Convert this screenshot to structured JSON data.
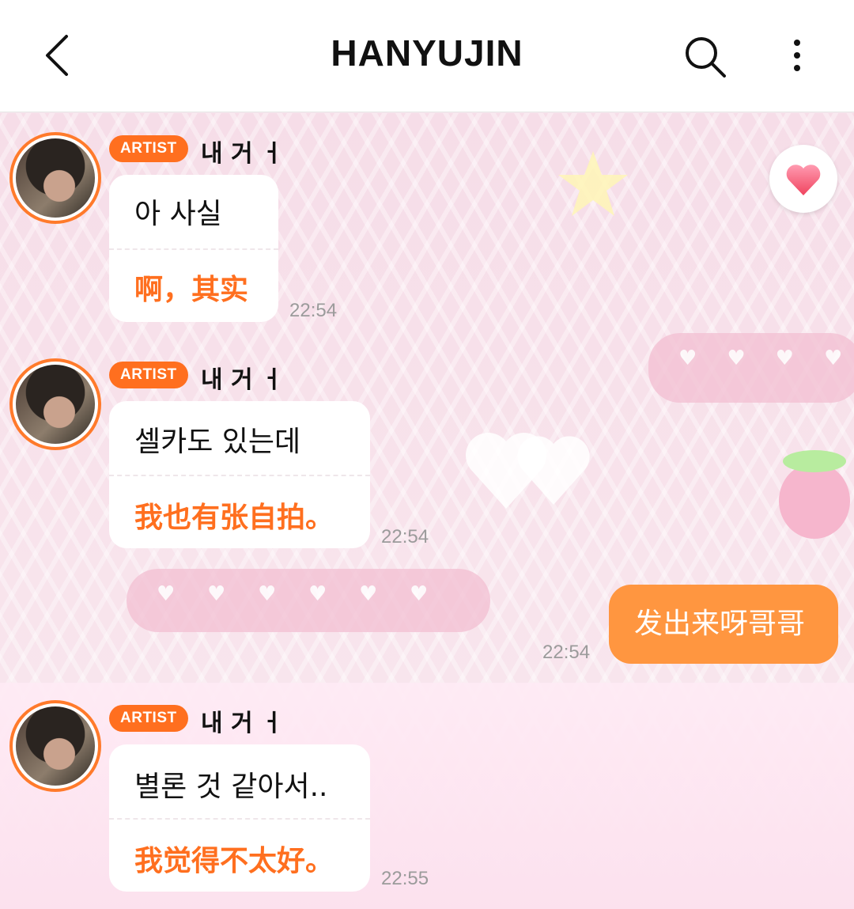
{
  "header": {
    "title": "HANYUJIN"
  },
  "messages": [
    {
      "badge": "ARTIST",
      "name": "내 거 ㅓ",
      "korean": "아 사실",
      "chinese": "啊，其实",
      "time": "22:54"
    },
    {
      "badge": "ARTIST",
      "name": "내 거 ㅓ",
      "korean": "셀카도 있는데",
      "chinese": "我也有张自拍。",
      "time": "22:54"
    },
    {
      "badge": "ARTIST",
      "name": "내 거 ㅓ",
      "korean": "별론 것 같아서..",
      "chinese": "我觉得不太好。",
      "time": "22:55"
    }
  ],
  "my_message": {
    "text": "发出来呀哥哥",
    "time": "22:54"
  },
  "icons": {
    "back": "chevron-left-icon",
    "search": "search-icon",
    "more": "more-vertical-icon",
    "heart": "heart-icon"
  },
  "colors": {
    "accent": "#ff6f1f",
    "my_bubble": "#ff9640",
    "background": "#f7e6ee"
  }
}
